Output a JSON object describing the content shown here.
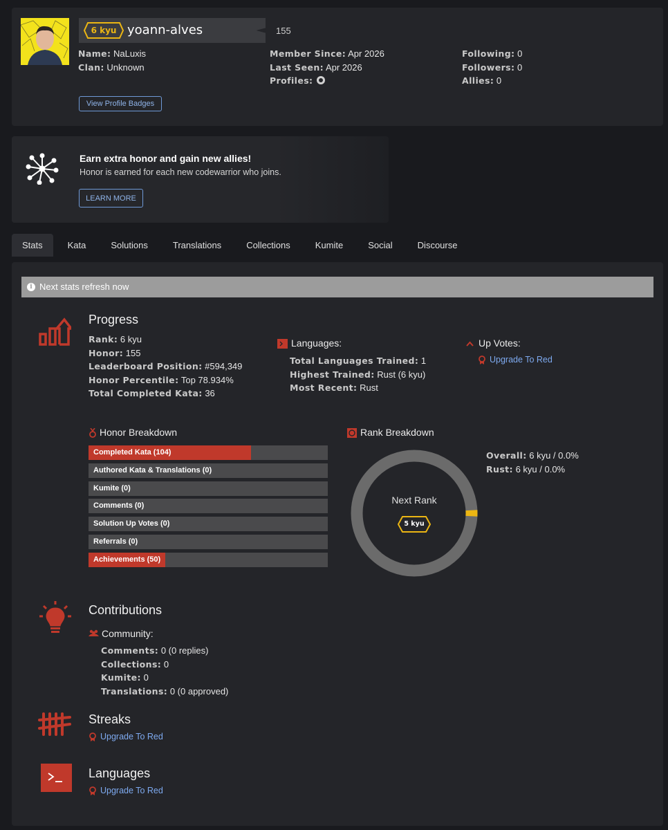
{
  "profile": {
    "rank": "6 kyu",
    "username": "yoann-alves",
    "honor": "155",
    "name_label": "Name:",
    "name": "NaLuxis",
    "clan_label": "Clan:",
    "clan": "Unknown",
    "member_since_label": "Member Since:",
    "member_since": "Apr 2026",
    "last_seen_label": "Last Seen:",
    "last_seen": "Apr 2026",
    "profiles_label": "Profiles:",
    "following_label": "Following:",
    "following": "0",
    "followers_label": "Followers:",
    "followers": "0",
    "allies_label": "Allies:",
    "allies": "0",
    "badges_button": "View Profile Badges"
  },
  "invite": {
    "title": "Earn extra honor and gain new allies!",
    "subtitle": "Honor is earned for each new codewarrior who joins.",
    "button": "LEARN MORE"
  },
  "tabs": [
    "Stats",
    "Kata",
    "Solutions",
    "Translations",
    "Collections",
    "Kumite",
    "Social",
    "Discourse"
  ],
  "stats": {
    "refresh_text": "Next stats refresh now",
    "progress": {
      "title": "Progress",
      "rank_label": "Rank:",
      "rank": "6 kyu",
      "honor_label": "Honor:",
      "honor": "155",
      "leaderboard_label": "Leaderboard Position:",
      "leaderboard": "#594,349",
      "percentile_label": "Honor Percentile:",
      "percentile": "Top 78.934%",
      "completed_label": "Total Completed Kata:",
      "completed": "36"
    },
    "languages": {
      "title": "Languages:",
      "total_label": "Total Languages Trained:",
      "total": "1",
      "highest_label": "Highest Trained:",
      "highest": "Rust (6 kyu)",
      "recent_label": "Most Recent:",
      "recent": "Rust"
    },
    "upvotes": {
      "title": "Up Votes:",
      "link": "Upgrade To Red"
    },
    "honor_breakdown": {
      "title": "Honor Breakdown",
      "items": [
        {
          "label": "Completed Kata (104)",
          "fill": 0.68
        },
        {
          "label": "Authored Kata & Translations (0)",
          "fill": 0
        },
        {
          "label": "Kumite (0)",
          "fill": 0
        },
        {
          "label": "Comments (0)",
          "fill": 0
        },
        {
          "label": "Solution Up Votes (0)",
          "fill": 0
        },
        {
          "label": "Referrals (0)",
          "fill": 0
        },
        {
          "label": "Achievements (50)",
          "fill": 0.32
        }
      ]
    },
    "rank_breakdown": {
      "title": "Rank Breakdown",
      "next_rank_label": "Next Rank",
      "next_rank": "5 kyu",
      "progress_fraction": 0.0,
      "overall_label": "Overall:",
      "overall": "6 kyu / 0.0%",
      "rust_label": "Rust:",
      "rust": "6 kyu / 0.0%"
    },
    "contributions": {
      "title": "Contributions",
      "community_label": "Community:",
      "comments_label": "Comments:",
      "comments": "0 (0 replies)",
      "collections_label": "Collections:",
      "collections": "0",
      "kumite_label": "Kumite:",
      "kumite": "0",
      "translations_label": "Translations:",
      "translations": "0 (0 approved)"
    },
    "streaks": {
      "title": "Streaks",
      "link": "Upgrade To Red"
    },
    "languages_section": {
      "title": "Languages",
      "link": "Upgrade To Red"
    }
  },
  "colors": {
    "accent_red": "#c0392b",
    "kyu_yellow": "#ecb613",
    "link_blue": "#7eaaf0",
    "panel": "#242529",
    "background": "#191a1e"
  }
}
